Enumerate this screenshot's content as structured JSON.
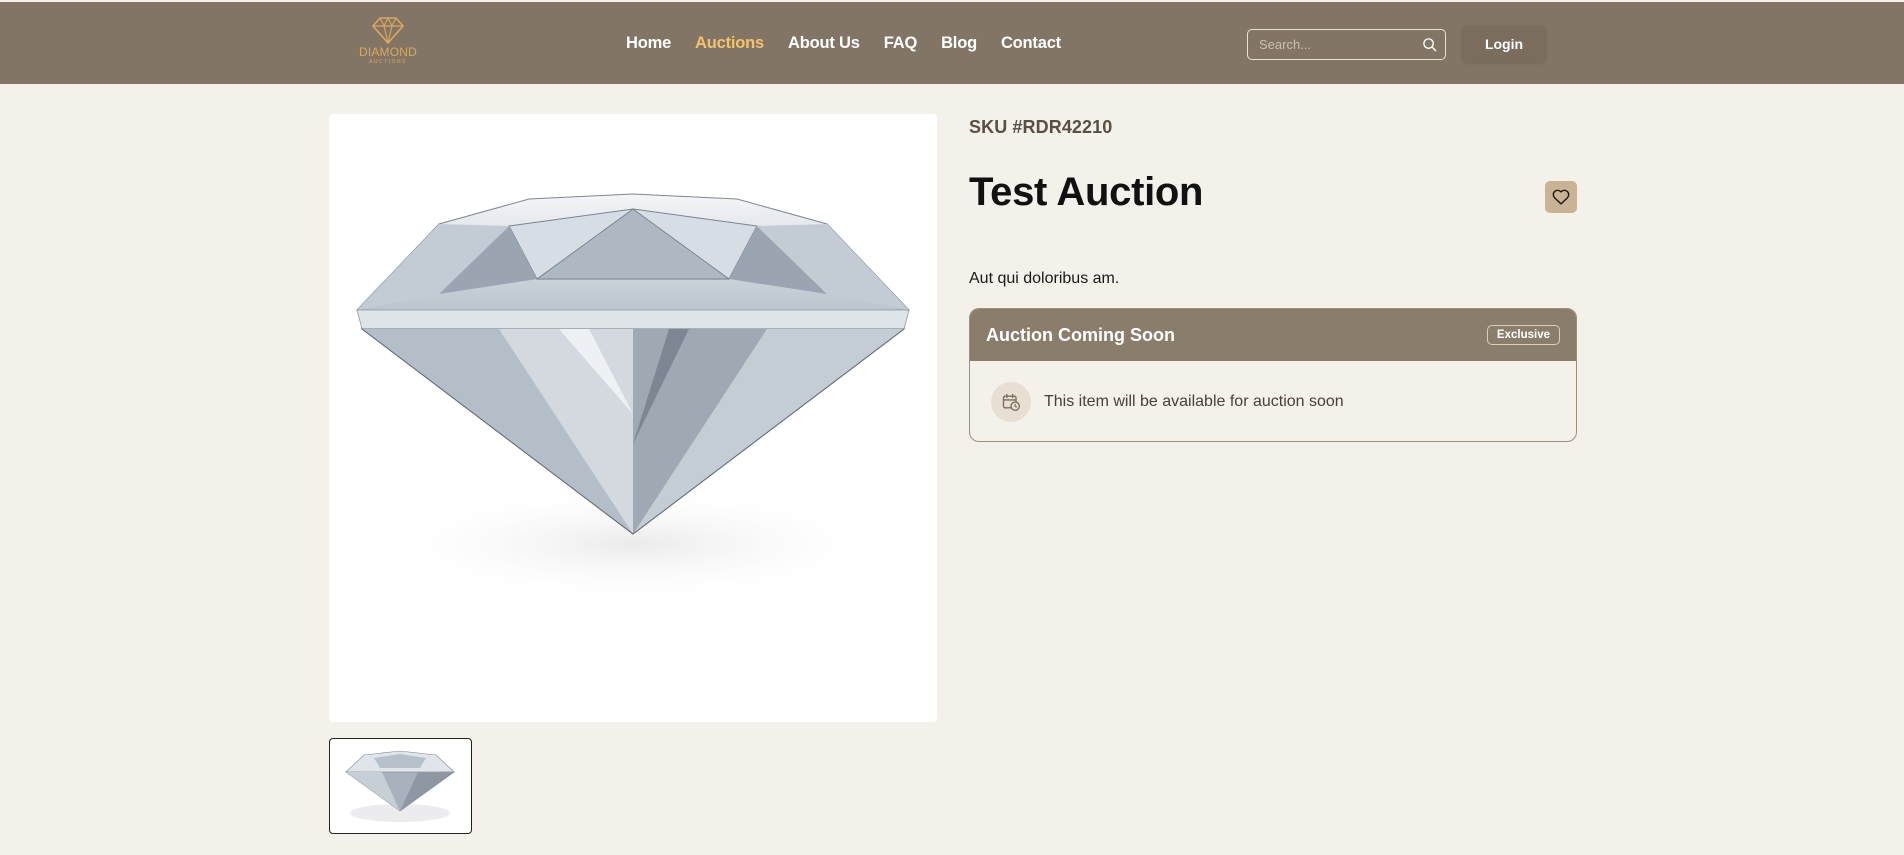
{
  "brand": {
    "name": "DIAMOND",
    "tagline": "AUCTIONS"
  },
  "nav": {
    "items": [
      {
        "label": "Home",
        "active": false
      },
      {
        "label": "Auctions",
        "active": true
      },
      {
        "label": "About Us",
        "active": false
      },
      {
        "label": "FAQ",
        "active": false
      },
      {
        "label": "Blog",
        "active": false
      },
      {
        "label": "Contact",
        "active": false
      }
    ]
  },
  "search": {
    "placeholder": "Search...",
    "icon": "search-icon"
  },
  "login": {
    "label": "Login"
  },
  "product": {
    "sku": "SKU #RDR42210",
    "title": "Test Auction",
    "description": "Aut qui doloribus am.",
    "favorite_icon": "heart-icon"
  },
  "auction_card": {
    "title": "Auction Coming Soon",
    "badge": "Exclusive",
    "message": "This item will be available for auction soon",
    "icon": "calendar-clock-icon"
  },
  "colors": {
    "header_bg": "#827565",
    "nav_active": "#f3c36b",
    "page_bg": "#f4f0ea",
    "card_header": "#8b7d6b",
    "favorite_bg": "#c9b394",
    "brand_gold": "#d9a95c"
  }
}
